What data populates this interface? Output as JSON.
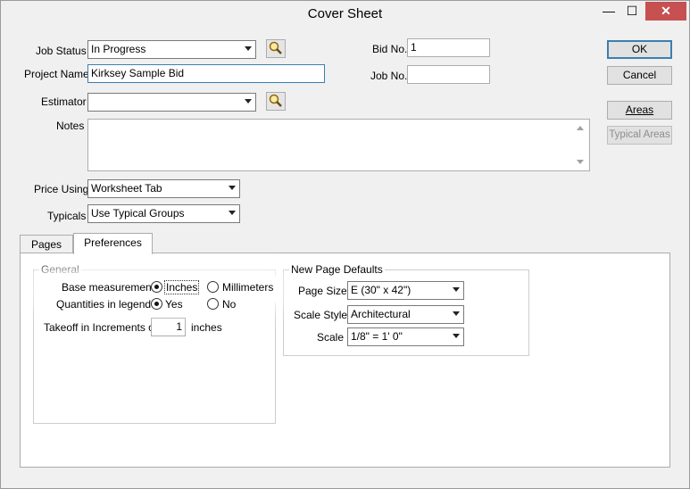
{
  "window": {
    "title": "Cover Sheet",
    "min_symbol": "—",
    "max_symbol": "☐",
    "close_symbol": "✕"
  },
  "job_status": {
    "label": "Job Status",
    "value": "In Progress",
    "icon": "magnifier-icon"
  },
  "project_name": {
    "label": "Project Name",
    "value": "Kirksey Sample Bid"
  },
  "estimator": {
    "label": "Estimator",
    "value": "",
    "icon": "magnifier-icon"
  },
  "notes": {
    "label": "Notes",
    "value": ""
  },
  "bid_no": {
    "label": "Bid No.",
    "value": "1"
  },
  "job_no": {
    "label": "Job No.",
    "value": ""
  },
  "price_using": {
    "label": "Price Using",
    "value": "Worksheet Tab"
  },
  "typicals": {
    "label": "Typicals",
    "value": "Use Typical Groups"
  },
  "buttons": {
    "ok": "OK",
    "cancel": "Cancel",
    "areas": "Areas",
    "typical_areas": "Typical Areas"
  },
  "tabs": [
    {
      "label": "Pages",
      "active": false
    },
    {
      "label": "Preferences",
      "active": true
    }
  ],
  "general": {
    "title": "General",
    "base_measurement_label": "Base measurement:",
    "inches_label": "Inches",
    "millimeters_label": "Millimeters",
    "base_measurement_selected": "Inches",
    "quantities_label": "Quantities in legend?",
    "yes_label": "Yes",
    "no_label": "No",
    "quantities_selected": "Yes",
    "takeoff_label": "Takeoff in Increments of",
    "takeoff_value": "1",
    "takeoff_unit": "inches"
  },
  "page_defaults": {
    "title": "New Page Defaults",
    "page_size_label": "Page Size",
    "page_size_value": "E (30\" x 42\")",
    "scale_style_label": "Scale Style",
    "scale_style_value": "Architectural",
    "scale_label": "Scale",
    "scale_value": "1/8\" = 1' 0\""
  },
  "colors": {
    "window_bg": "#f0f0f0",
    "close_button": "#c75050",
    "default_button_border": "#3c7fb1"
  }
}
